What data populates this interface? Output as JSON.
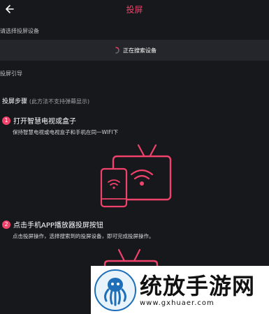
{
  "header": {
    "title": "投屏",
    "back_icon": "back-arrow-icon"
  },
  "device_section": {
    "label": "请选择投屏设备",
    "searching_text": "正在搜索设备"
  },
  "guide_section": {
    "label": "投屏引导"
  },
  "steps": {
    "title": "投屏步骤",
    "note": "(此方法不支持弹幕显示)",
    "items": [
      {
        "number": "1",
        "heading": "打开智慧电视或盒子",
        "desc": "保持智慧电视或电视盒子和手机在同一WIFI下"
      },
      {
        "number": "2",
        "heading": "点击手机APP播放器投屏按钮",
        "desc": "点击投屏操作，选择搜索到的投屏设备，即可完成投屏操作。"
      }
    ]
  },
  "watermark": {
    "name": "统放手游网",
    "url": "www.gxhuaer.com"
  },
  "colors": {
    "accent": "#f0426a",
    "background": "#17181c",
    "row": "#24262b"
  }
}
